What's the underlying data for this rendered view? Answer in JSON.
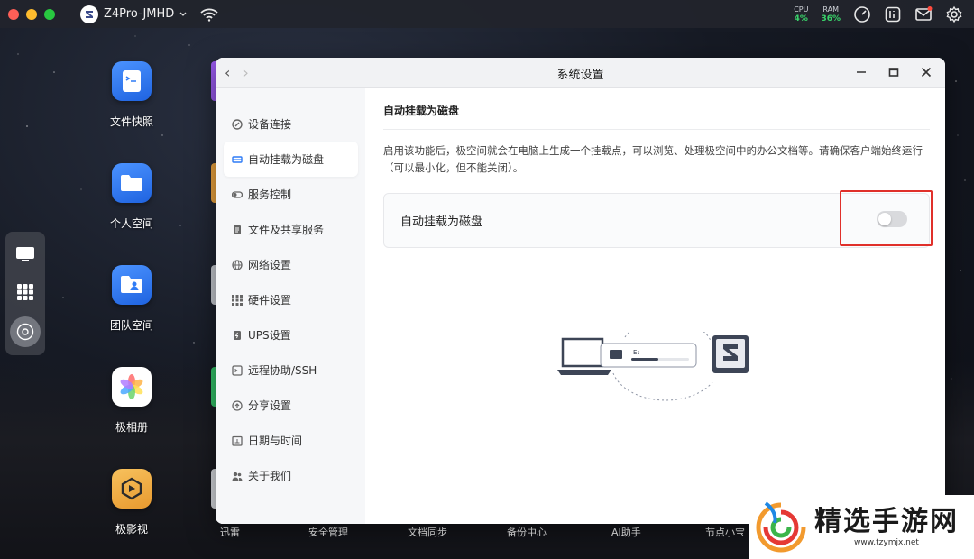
{
  "topbar": {
    "device_name": "Z4Pro-JMHD",
    "cpu_label": "CPU",
    "cpu_value": "4%",
    "ram_label": "RAM",
    "ram_value": "36%"
  },
  "desktop": {
    "apps": [
      {
        "label": "文件快照",
        "icon": "file-snapshot-icon",
        "color": "#2f7cf6"
      },
      {
        "label": "个人空间",
        "icon": "folder-icon",
        "color": "#2f86f7"
      },
      {
        "label": "团队空间",
        "icon": "team-folder-icon",
        "color": "#2f86f7"
      },
      {
        "label": "极相册",
        "icon": "photo-flower-icon",
        "color": "#ffffff"
      },
      {
        "label": "极影视",
        "icon": "video-icon",
        "color": "#f2b24a"
      }
    ],
    "bottom_labels": [
      "迅雷",
      "安全管理",
      "文档同步",
      "备份中心",
      "AI助手",
      "节点小宝"
    ]
  },
  "window": {
    "title": "系统设置",
    "back": "‹",
    "forward": "›"
  },
  "sidebar": {
    "items": [
      {
        "label": "设备连接",
        "icon": "link-icon"
      },
      {
        "label": "自动挂载为磁盘",
        "icon": "drive-icon"
      },
      {
        "label": "服务控制",
        "icon": "toggle-icon"
      },
      {
        "label": "文件及共享服务",
        "icon": "document-icon"
      },
      {
        "label": "网络设置",
        "icon": "globe-icon"
      },
      {
        "label": "硬件设置",
        "icon": "grid-icon"
      },
      {
        "label": "UPS设置",
        "icon": "battery-icon"
      },
      {
        "label": "远程协助/SSH",
        "icon": "terminal-icon"
      },
      {
        "label": "分享设置",
        "icon": "share-icon"
      },
      {
        "label": "日期与时间",
        "icon": "calendar-icon"
      },
      {
        "label": "关于我们",
        "icon": "users-icon"
      }
    ],
    "active_index": 1
  },
  "content": {
    "header": "自动挂载为磁盘",
    "description": "启用该功能后，极空间就会在电脑上生成一个挂载点，可以浏览、处理极空间中的办公文档等。请确保客户端始终运行（可以最小化，但不能关闭）。",
    "card_label": "自动挂载为磁盘",
    "toggle_on": false,
    "drive_letter": "E:"
  },
  "watermark": {
    "main": "精选手游网",
    "url": "www.tzymjx.net"
  },
  "colors": {
    "accent": "#2f7cf6",
    "highlight": "#e0302a",
    "toggle_off": "#d9dadd",
    "cpu_green": "#39d36a"
  }
}
